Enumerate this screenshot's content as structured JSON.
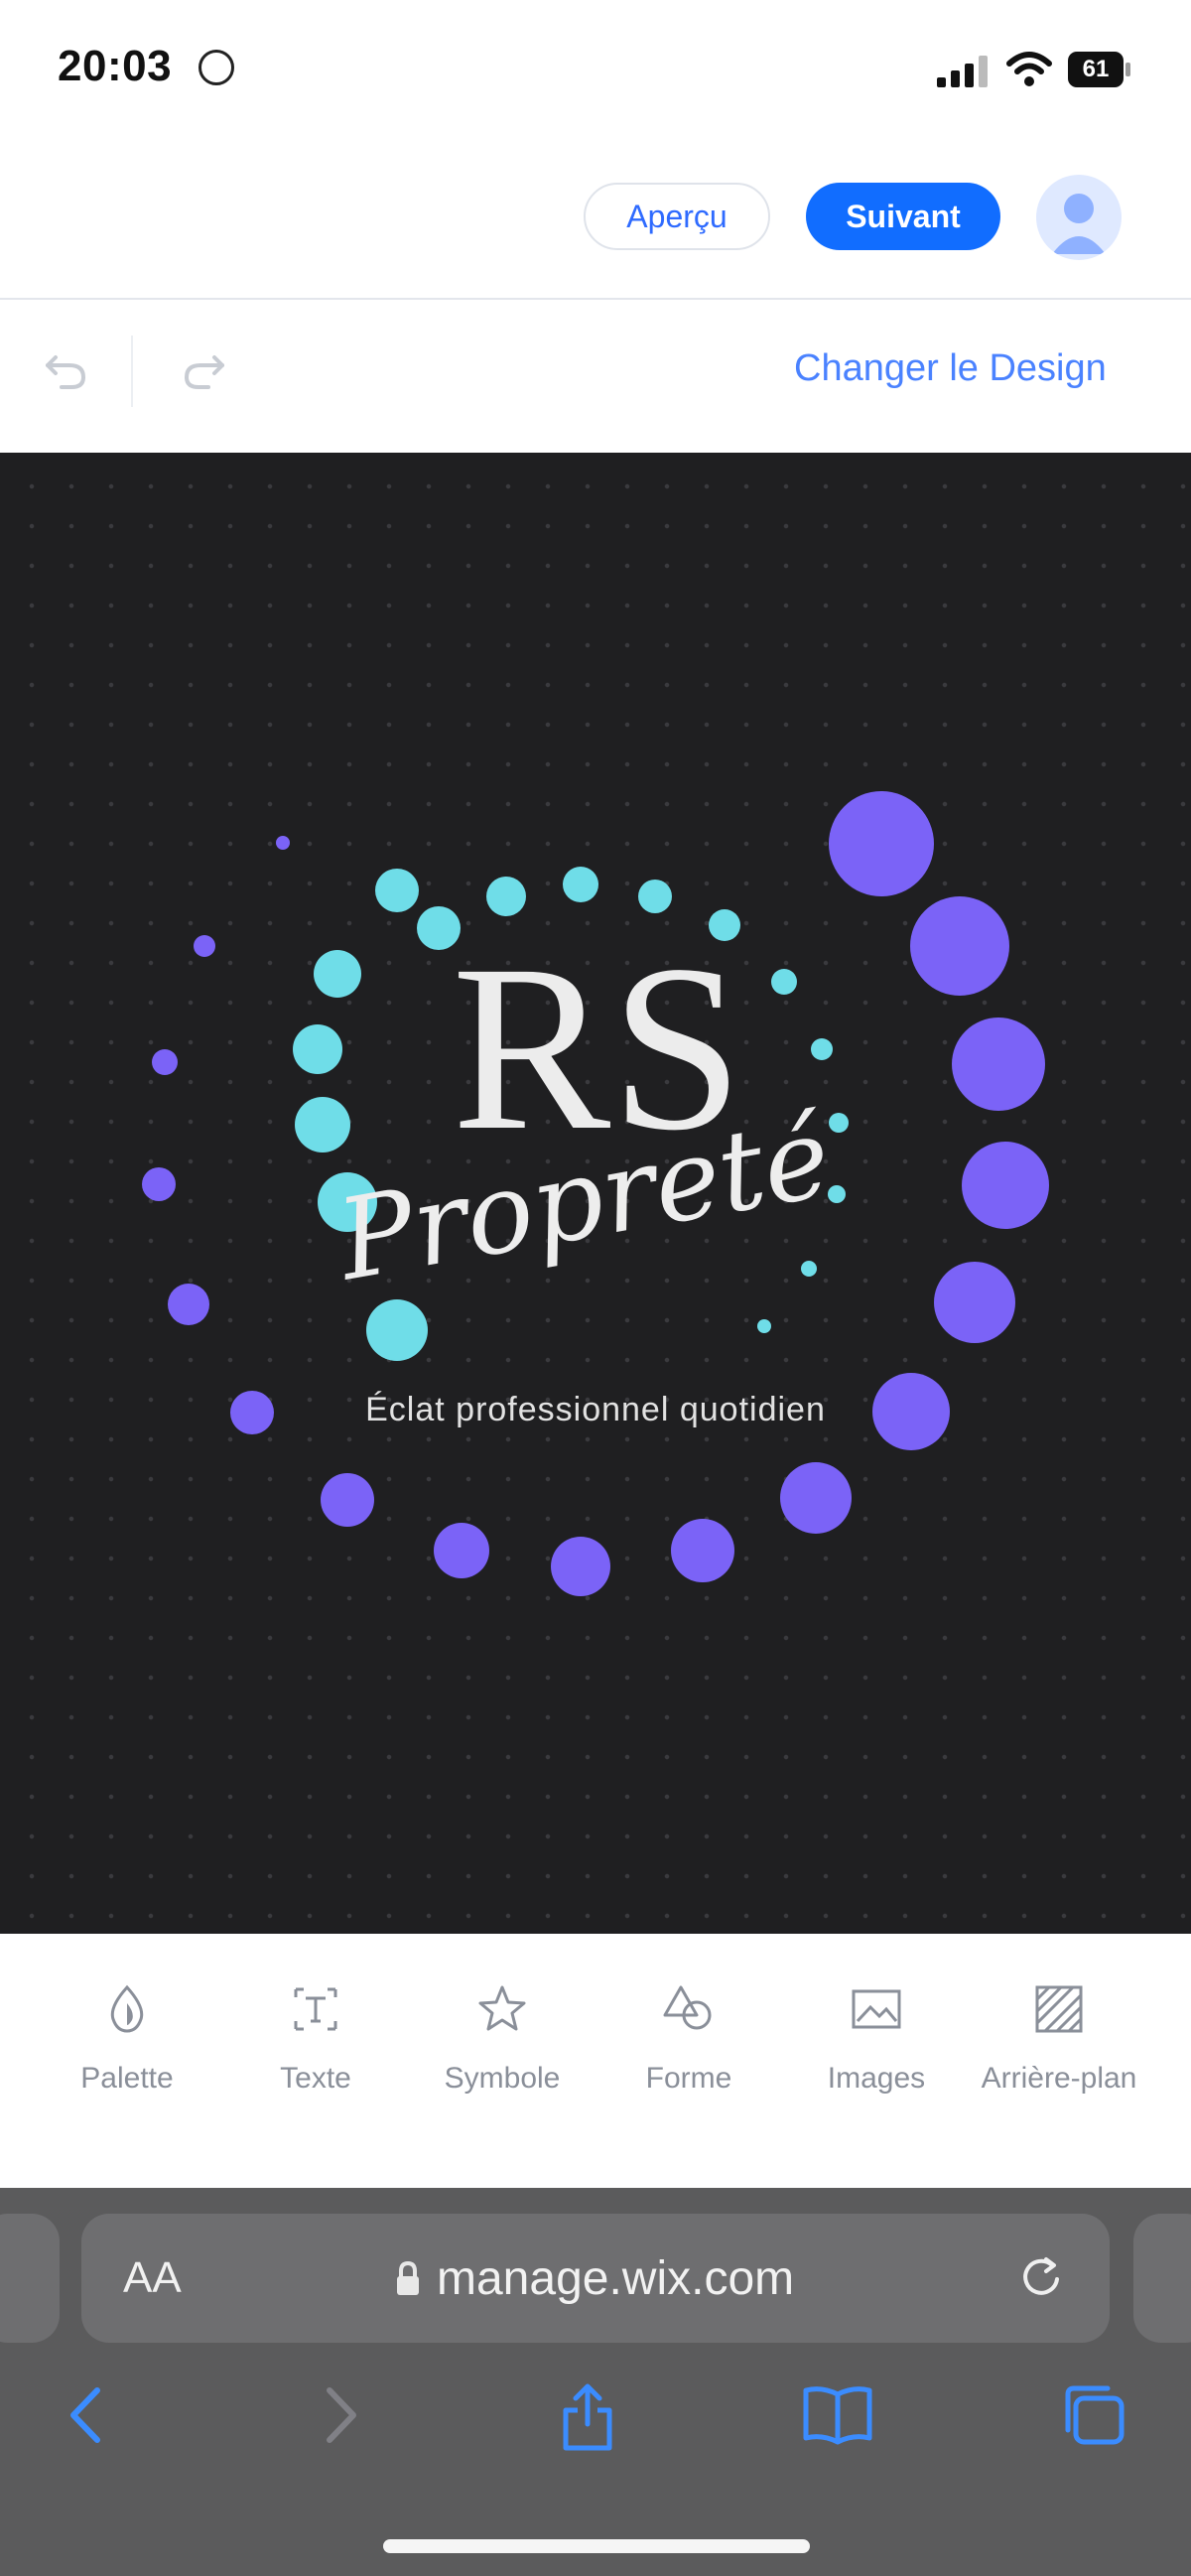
{
  "status": {
    "time": "20:03",
    "battery": "61"
  },
  "header": {
    "preview_label": "Aperçu",
    "next_label": "Suivant"
  },
  "toolbar": {
    "change_design_label": "Changer le Design"
  },
  "logo": {
    "initials": "RS",
    "script_word": "Propreté",
    "tagline": "Éclat professionnel quotidien",
    "colors": {
      "background": "#1f1f21",
      "cyan": "#6fdde8",
      "violet": "#7b63f7",
      "text": "#eaeaea"
    }
  },
  "tools": [
    {
      "label": "Palette",
      "icon": "palette-icon"
    },
    {
      "label": "Texte",
      "icon": "text-icon"
    },
    {
      "label": "Symbole",
      "icon": "star-icon"
    },
    {
      "label": "Forme",
      "icon": "shapes-icon"
    },
    {
      "label": "Images",
      "icon": "image-icon"
    },
    {
      "label": "Arrière-plan",
      "icon": "background-icon"
    }
  ],
  "browser": {
    "aa_label": "AA",
    "url": "manage.wix.com"
  }
}
